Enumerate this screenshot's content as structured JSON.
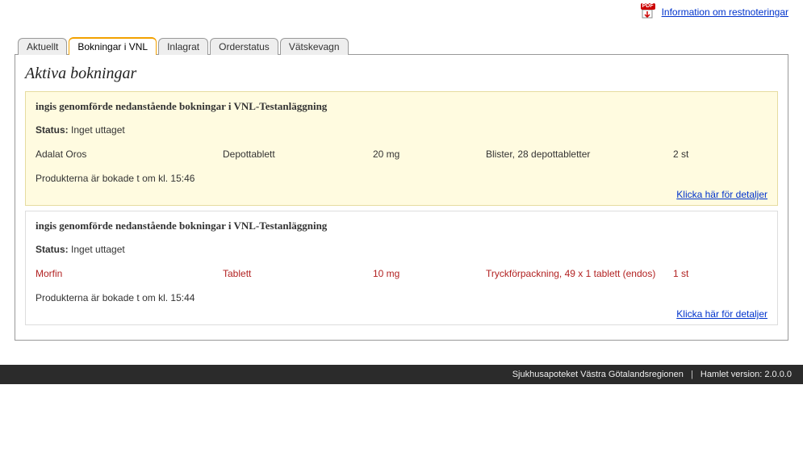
{
  "topLink": {
    "text": "Information om restnoteringar",
    "iconLabel": "PDF"
  },
  "tabs": [
    {
      "id": "aktuellt",
      "label": "Aktuellt",
      "active": false
    },
    {
      "id": "bokningar",
      "label": "Bokningar i VNL",
      "active": true
    },
    {
      "id": "inlagrat",
      "label": "Inlagrat",
      "active": false
    },
    {
      "id": "orderstatus",
      "label": "Orderstatus",
      "active": false
    },
    {
      "id": "vatskevagn",
      "label": "Vätskevagn",
      "active": false
    }
  ],
  "panel": {
    "heading": "Aktiva bokningar",
    "bookings": [
      {
        "highlight": true,
        "title": "ingis genomförde nedanstående bokningar i VNL-Testanläggning",
        "statusLabel": "Status:",
        "statusValue": "Inget uttaget",
        "rows": [
          {
            "special": false,
            "name": "Adalat Oros",
            "form": "Depottablett",
            "strength": "20 mg",
            "pack": "Blister, 28 depottabletter",
            "qty": "2 st"
          }
        ],
        "footerText": "Produkterna är bokade t om kl. 15:46",
        "detailsLink": "Klicka här för detaljer"
      },
      {
        "highlight": false,
        "title": "ingis genomförde nedanstående bokningar i VNL-Testanläggning",
        "statusLabel": "Status:",
        "statusValue": "Inget uttaget",
        "rows": [
          {
            "special": true,
            "name": "Morfin",
            "form": "Tablett",
            "strength": "10 mg",
            "pack": "Tryckförpackning, 49 x 1 tablett (endos)",
            "qty": "1 st"
          }
        ],
        "footerText": "Produkterna är bokade t om kl. 15:44",
        "detailsLink": "Klicka här för detaljer"
      }
    ]
  },
  "footer": {
    "org": "Sjukhusapoteket Västra Götalandsregionen",
    "version": "Hamlet version: 2.0.0.0"
  }
}
